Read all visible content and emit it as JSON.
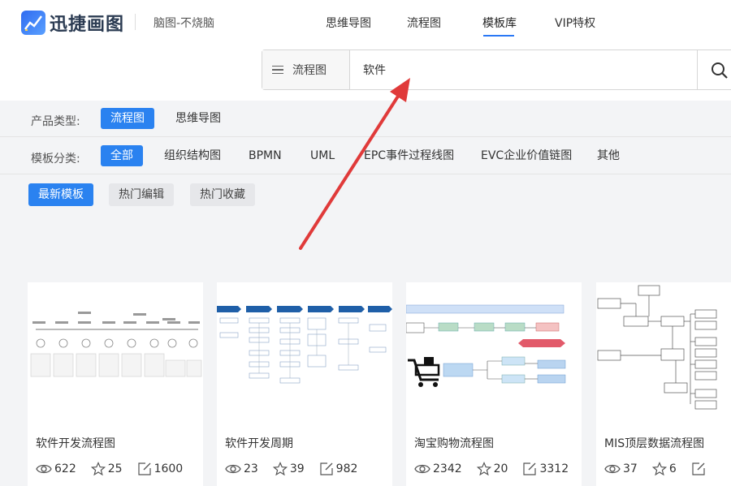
{
  "brand": {
    "name": "迅捷画图",
    "slogan": "脑图-不烧脑"
  },
  "nav": [
    {
      "label": "思维导图"
    },
    {
      "label": "流程图"
    },
    {
      "label": "模板库",
      "active": true
    },
    {
      "label": "VIP特权"
    }
  ],
  "search": {
    "type_label": "流程图",
    "value": "软件"
  },
  "product_type": {
    "label": "产品类型:",
    "options": [
      {
        "label": "流程图",
        "active": true
      },
      {
        "label": "思维导图"
      }
    ]
  },
  "category": {
    "label": "模板分类:",
    "options": [
      {
        "label": "全部",
        "active": true
      },
      {
        "label": "组织结构图"
      },
      {
        "label": "BPMN"
      },
      {
        "label": "UML"
      },
      {
        "label": "EPC事件过程线图"
      },
      {
        "label": "EVC企业价值链图"
      },
      {
        "label": "其他"
      }
    ]
  },
  "sort": [
    {
      "label": "最新模板",
      "active": true
    },
    {
      "label": "热门编辑"
    },
    {
      "label": "热门收藏"
    }
  ],
  "cards": [
    {
      "title": "软件开发流程图",
      "views": "622",
      "stars": "25",
      "edits": "1600"
    },
    {
      "title": "软件开发周期",
      "views": "23",
      "stars": "39",
      "edits": "982"
    },
    {
      "title": "淘宝购物流程图",
      "views": "2342",
      "stars": "20",
      "edits": "3312"
    },
    {
      "title": "MIS顶层数据流程图",
      "views": "37",
      "stars": "6",
      "edits": ""
    }
  ],
  "colors": {
    "accent": "#2a82f0",
    "annotation_arrow": "#e03a3a"
  }
}
